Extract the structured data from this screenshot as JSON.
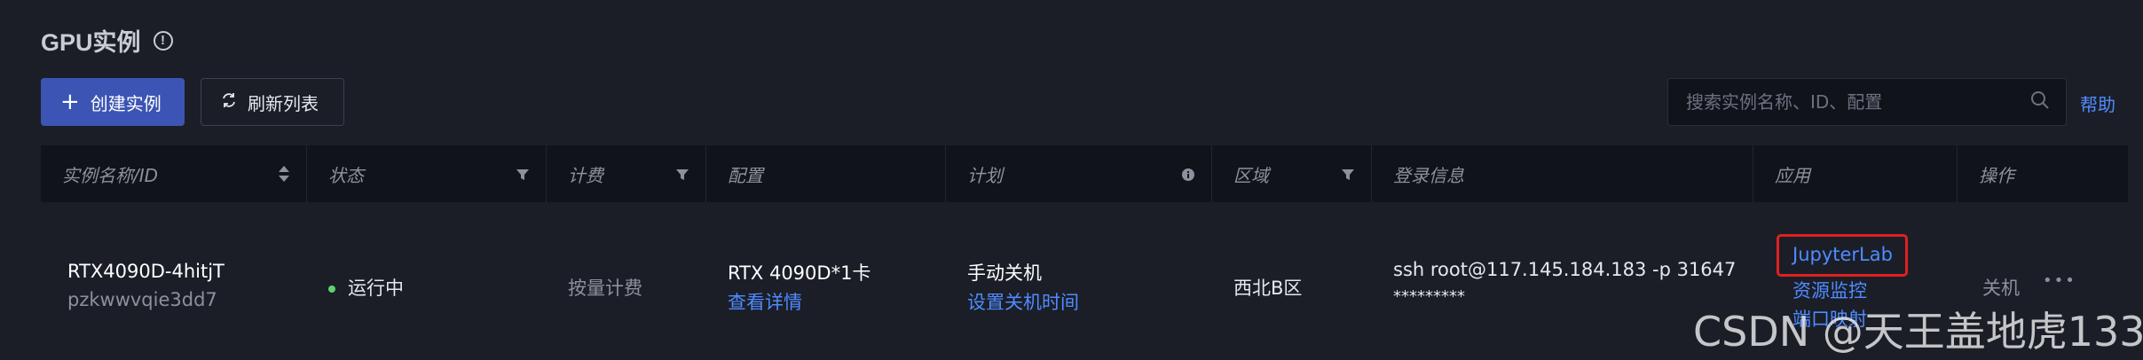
{
  "page": {
    "title": "GPU实例",
    "info_icon": "!"
  },
  "toolbar": {
    "create_label": "创建实例",
    "refresh_label": "刷新列表",
    "search_placeholder": "搜索实例名称、ID、配置",
    "help_label": "帮助"
  },
  "table": {
    "columns": {
      "name": "实例名称/ID",
      "status": "状态",
      "billing": "计费",
      "config": "配置",
      "plan": "计划",
      "region": "区域",
      "login": "登录信息",
      "apps": "应用",
      "actions": "操作"
    },
    "rows": [
      {
        "name": "RTX4090D-4hitjT",
        "id": "pzkwwvqie3dd7",
        "status": "运行中",
        "billing": "按量计费",
        "config": "RTX 4090D*1卡",
        "config_link": "查看详情",
        "plan": "手动关机",
        "plan_link": "设置关机时间",
        "region": "西北B区",
        "ssh": "ssh root@117.145.184.183 -p 31647",
        "password": "*********",
        "app_jupyter": "JupyterLab",
        "app_monitor": "资源监控",
        "app_port": "端口映射",
        "action_shutdown": "关机",
        "action_more": "•••"
      }
    ]
  },
  "watermark": "CSDN @天王盖地虎133",
  "colors": {
    "background": "#1b1e27",
    "header_bg": "#11131a",
    "primary": "#3c55b4",
    "link": "#4f8bff",
    "running": "#5fd26e",
    "highlight": "#e02020"
  }
}
